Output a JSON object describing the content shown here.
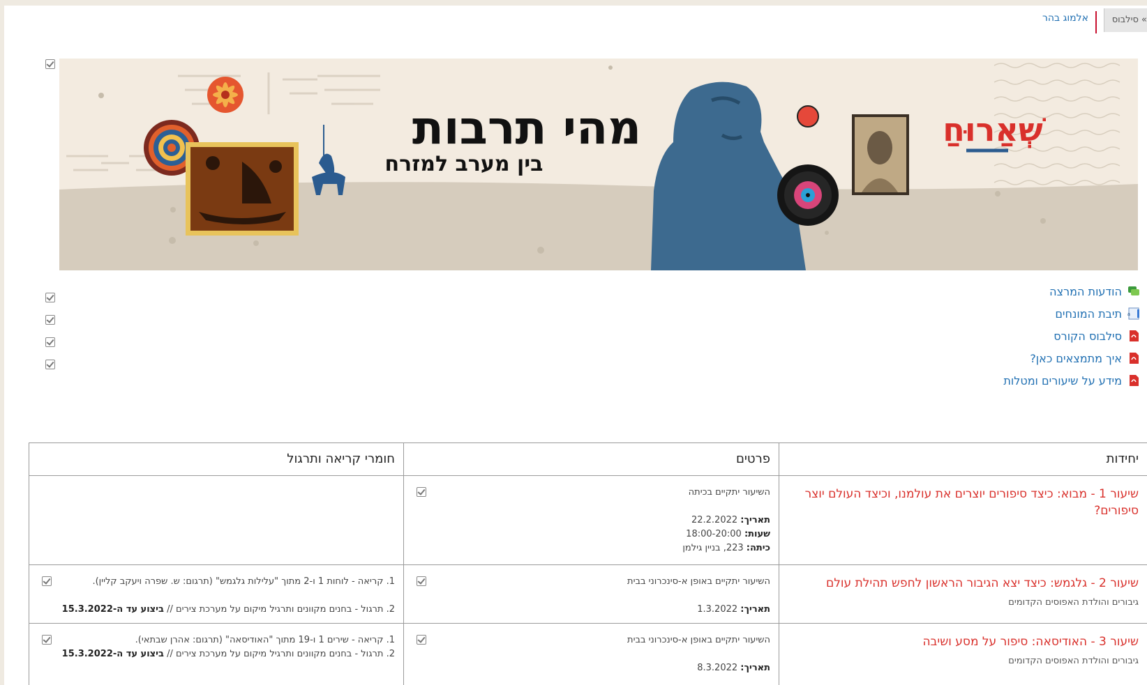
{
  "nav": {
    "breadcrumb_button": "» סילבוס",
    "breadcrumb_link": "אלמוג בהר"
  },
  "banner": {
    "title": "מהי תרבות",
    "subtitle": "בין מערב למזרח",
    "logo": "שְׁאַרוּחַ"
  },
  "resources": [
    {
      "label": "הודעות המרצה",
      "icon": "forum-icon"
    },
    {
      "label": "תיבת המונחים",
      "icon": "glossary-icon"
    },
    {
      "label": "סילבוס הקורס",
      "icon": "pdf-icon"
    },
    {
      "label": "איך מתמצאים כאן?",
      "icon": "pdf-icon"
    },
    {
      "label": "מידע על שיעורים ומטלות",
      "icon": "pdf-icon"
    }
  ],
  "table": {
    "headers": [
      "יחידות",
      "פרטים",
      "חומרי קריאה ותרגול"
    ],
    "rows": [
      {
        "title": "שיעור 1 - מבוא: כיצד סיפורים יוצרים את עולמנו, וכיצד העולם יוצר סיפורים?",
        "subtitle": "",
        "details_note": "השיעור יתקיים בכיתה",
        "date_label": "תאריך:",
        "date": "22.2.2022",
        "hours_label": "שעות:",
        "hours": "18:00-20:00",
        "room_label": "כיתה:",
        "room": "223, בניין גילמן",
        "mat1": "",
        "mat2_a": "",
        "mat2_b": ""
      },
      {
        "title": "שיעור 2 - גלגמש: כיצד יצא הגיבור הראשון לחפש תהילת עולם",
        "subtitle": "גיבורים והולדת האפוסים הקדומים",
        "details_note": "השיעור יתקיים באופן א-סינכרוני בבית",
        "date_label": "תאריך:",
        "date": "1.3.2022",
        "mat1": "1. קריאה - לוחות 1 ו-2 מתוך \"עלילות גלגמש\" (תרגום: ש. שפרה ויעקב קליין).",
        "mat2_a": "2. תרגול - בחנים מקוונים ותרגיל מיקום על מערכת צירים //",
        "mat2_b": "ביצוע עד ה-15.3.2022"
      },
      {
        "title": "שיעור 3 - האודיסאה: סיפור על מסע ושיבה",
        "subtitle": "גיבורים והולדת האפוסים הקדומים",
        "details_note": "השיעור יתקיים באופן א-סינכרוני בבית",
        "date_label": "תאריך:",
        "date": "8.3.2022",
        "mat1": "1. קריאה - שירים 1 ו-19 מתוך \"האודיסאה\" (תרגום: אהרן שבתאי).",
        "mat2_a": "2. תרגול - בחנים מקוונים ותרגיל מיקום על מערכת צירים //",
        "mat2_b": "ביצוע עד ה-15.3.2022"
      }
    ]
  },
  "colors": {
    "link": "#1f6fb2",
    "lesson_title": "#d9302b",
    "banner_bg": "#f3ebe0",
    "banner_ground": "#d6ccbd"
  }
}
